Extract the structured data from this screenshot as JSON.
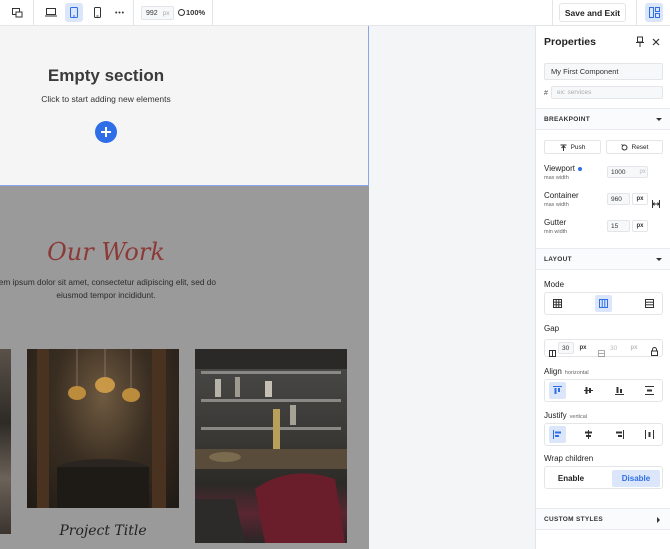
{
  "toolbar": {
    "width_value": "992",
    "width_unit": "px",
    "zoom": "100%",
    "save_label": "Save and Exit"
  },
  "canvas": {
    "empty_title": "Empty section",
    "empty_subtitle": "Click to start adding new elements",
    "heading": "Our Work",
    "body_text": "rem ipsum dolor sit amet, consectetur adipiscing elit, sed do eiusmod tempor incididunt.",
    "project_title": "Project Title"
  },
  "panel": {
    "title": "Properties",
    "component_name": "My First Component",
    "id_placeholder": "ex: services",
    "id_prefix": "#",
    "breakpoint": {
      "label": "BREAKPOINT",
      "push_label": "Push",
      "reset_label": "Reset",
      "viewport_label": "Viewport",
      "viewport_sub": "max width",
      "viewport_value": "1000",
      "viewport_unit": "px",
      "container_label": "Container",
      "container_sub": "max width",
      "container_value": "960",
      "container_unit": "px",
      "gutter_label": "Gutter",
      "gutter_sub": "min width",
      "gutter_value": "15",
      "gutter_unit": "px"
    },
    "layout": {
      "label": "LAYOUT",
      "mode_label": "Mode",
      "gap_label": "Gap",
      "gap_value": "30",
      "gap_unit": "px",
      "gap_value2": "30",
      "gap_unit2": "px",
      "align_label": "Align",
      "align_sub": "horizontal",
      "justify_label": "Justify",
      "justify_sub": "vertical",
      "wrap_label": "Wrap children",
      "wrap_enable": "Enable",
      "wrap_disable": "Disable"
    },
    "custom_styles_label": "CUSTOM STYLES"
  },
  "colors": {
    "accent": "#2e6fe8",
    "accent_light": "#dce6fb",
    "heading_red": "#8b3a38"
  }
}
